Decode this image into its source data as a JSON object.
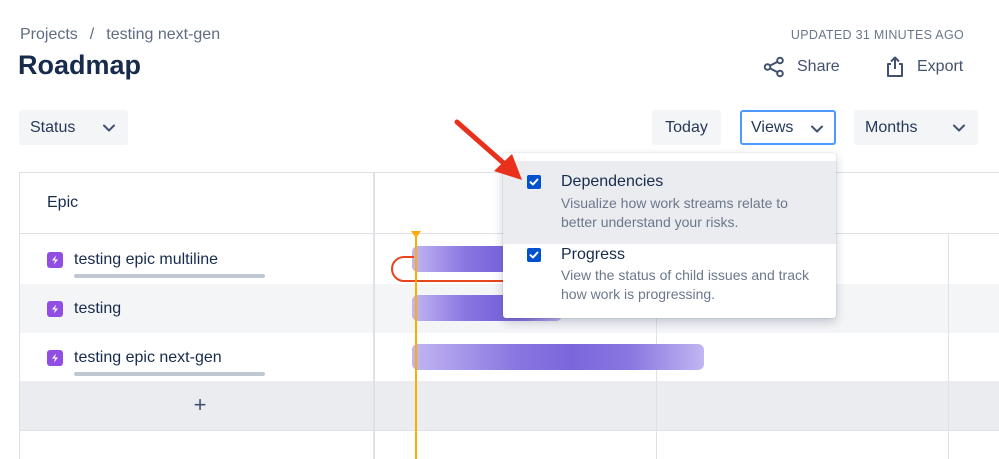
{
  "breadcrumb": {
    "project": "Projects",
    "separator": "/",
    "current": "testing next-gen"
  },
  "page_title": "Roadmap",
  "updated": "UPDATED 31 MINUTES AGO",
  "header_actions": {
    "share": "Share",
    "export": "Export"
  },
  "toolbar": {
    "status": "Status",
    "today": "Today",
    "views": "Views",
    "months": "Months"
  },
  "table": {
    "header": "Epic",
    "rows": [
      {
        "name": "testing epic multiline",
        "icon": "epic-icon",
        "progress": 0
      },
      {
        "name": "testing",
        "icon": "epic-icon"
      },
      {
        "name": "testing epic next-gen",
        "icon": "epic-icon",
        "progress": 0
      }
    ],
    "add_label": "+"
  },
  "views_menu": {
    "items": [
      {
        "title": "Dependencies",
        "description": "Visualize how work streams relate to better understand your risks.",
        "checked": true
      },
      {
        "title": "Progress",
        "description": "View the status of child issues and track how work is progressing.",
        "checked": true
      }
    ]
  },
  "colors": {
    "epic": "#904ee2",
    "bar": "#8b77e0",
    "today_line": "#ffab00",
    "checkbox": "#0052cc",
    "focus": "#4c9aff",
    "arrow": "#e8301c",
    "dependency": "#e8441f"
  }
}
